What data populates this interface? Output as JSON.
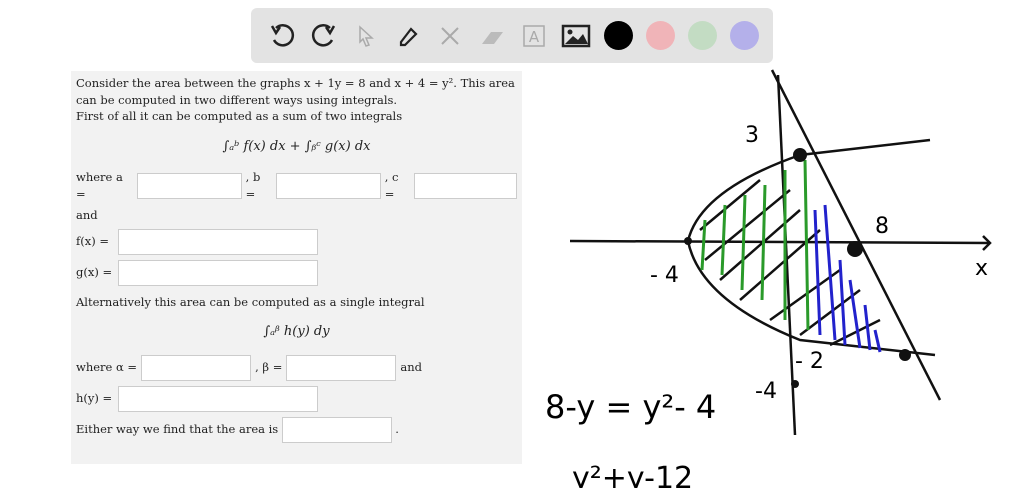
{
  "toolbar": {
    "tools": [
      "undo",
      "redo",
      "select",
      "pen",
      "tools",
      "eraser",
      "text",
      "image"
    ],
    "colors": [
      "#000000",
      "#f0b4b8",
      "#c3dcc3",
      "#b4b0ea"
    ]
  },
  "problem": {
    "intro": "Consider the area between the graphs x + 1y = 8 and x + 4 = y². This area can be computed in two different ways using integrals.",
    "line2": "First of all it can be computed as a sum of two integrals",
    "integral1": "∫ₐᵇ f(x) dx + ∫ᵦᶜ g(x) dx",
    "where_a": "where a =",
    "b": ", b =",
    "c": ", c =",
    "and": "and",
    "fx": "f(x) =",
    "gx": "g(x) =",
    "alt": "Alternatively this area can be computed as a single integral",
    "integral2": "∫ₐᵝ h(y) dy",
    "where_alpha": "where α =",
    "beta": ", β =",
    "and2": "and",
    "hy": "h(y) =",
    "area": "Either way we find that the area is",
    "period": "."
  },
  "sketch": {
    "label_3": "3",
    "label_8": "8",
    "label_neg4_x": "- 4",
    "label_x": "x",
    "label_neg2": "- 2",
    "label_neg4_y": "-4",
    "equation1": "8-y = y²- 4",
    "equation2": "y²+y-12"
  }
}
